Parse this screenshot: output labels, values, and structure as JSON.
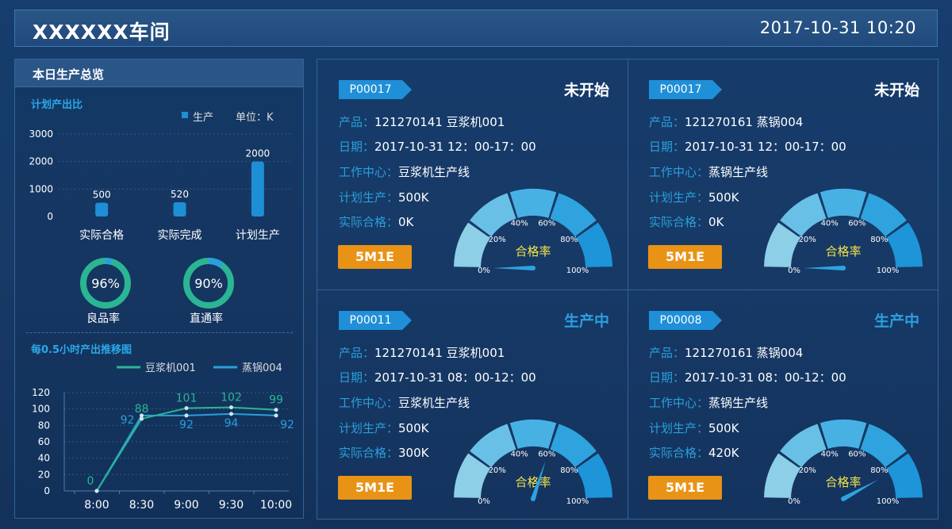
{
  "header": {
    "title": "XXXXXX车间",
    "datetime": "2017-10-31 10:20"
  },
  "overview": {
    "title": "本日生产总览",
    "plan_section": "计划产出比",
    "legend_label": "生产",
    "unit_label": "单位：K",
    "bar_color": "#1e8fd6"
  },
  "rates": [
    {
      "value": "96%",
      "label": "良品率",
      "fraction": 0.96
    },
    {
      "value": "90%",
      "label": "直通率",
      "fraction": 0.9
    }
  ],
  "trend": {
    "title": "每0.5小时产出推移图"
  },
  "chart_data": [
    {
      "type": "bar",
      "categories": [
        "实际合格",
        "实际完成",
        "计划生产"
      ],
      "series": [
        {
          "name": "生产",
          "values": [
            500,
            520,
            2000
          ]
        }
      ],
      "data_labels": [
        "500",
        "520",
        "2000"
      ],
      "y_ticks": [
        "3000",
        "2000",
        "1000",
        "0"
      ],
      "ylim": [
        0,
        3000
      ],
      "legend": "top-right"
    },
    {
      "type": "line",
      "categories": [
        "8:00",
        "8:30",
        "9:00",
        "9:30",
        "10:00"
      ],
      "series": [
        {
          "name": "豆浆机001",
          "values": [
            0,
            88,
            101,
            102,
            99
          ],
          "labels": [
            "0",
            "88",
            "101",
            "102",
            "99"
          ],
          "color": "#2bb593"
        },
        {
          "name": "蒸锅004",
          "values": [
            0,
            92,
            92,
            94,
            92
          ],
          "labels": [
            "",
            "92",
            "92",
            "94",
            "92"
          ],
          "color": "#2a9fd9"
        }
      ],
      "y_ticks": [
        "120",
        "100",
        "80",
        "60",
        "40",
        "20",
        "0"
      ],
      "ylim": [
        0,
        120
      ],
      "legend": "top-right"
    }
  ],
  "cards": [
    {
      "tag": "P00017",
      "status": "未开始",
      "status_color": "#ffffff",
      "labels": [
        "产品：",
        "日期：",
        "工作中心：",
        "计划生产：",
        "实际合格："
      ],
      "values": [
        "121270141  豆浆机001",
        "2017-10-31  12：00-17：00",
        "豆浆机生产线",
        "500K",
        "0K"
      ],
      "button": "5M1E",
      "gauge_value": 0.0
    },
    {
      "tag": "P00017",
      "status": "未开始",
      "status_color": "#ffffff",
      "labels": [
        "产品：",
        "日期：",
        "工作中心：",
        "计划生产：",
        "实际合格："
      ],
      "values": [
        "121270161  蒸锅004",
        "2017-10-31  12：00-17：00",
        "蒸锅生产线",
        "500K",
        "0K"
      ],
      "button": "5M1E",
      "gauge_value": 0.0
    },
    {
      "tag": "P00011",
      "status": "生产中",
      "status_color": "#2a9fe0",
      "labels": [
        "产品：",
        "日期：",
        "工作中心：",
        "计划生产：",
        "实际合格："
      ],
      "values": [
        "121270141  豆浆机001",
        "2017-10-31  08：00-12：00",
        "豆浆机生产线",
        "500K",
        "300K"
      ],
      "button": "5M1E",
      "gauge_value": 0.6
    },
    {
      "tag": "P00008",
      "status": "生产中",
      "status_color": "#2a9fe0",
      "labels": [
        "产品：",
        "日期：",
        "工作中心：",
        "计划生产：",
        "实际合格："
      ],
      "values": [
        "121270161  蒸锅004",
        "2017-10-31  08：00-12：00",
        "蒸锅生产线",
        "500K",
        "420K"
      ],
      "button": "5M1E",
      "gauge_value": 0.84
    }
  ],
  "gauge": {
    "label": "合格率",
    "ticks": [
      "0%",
      "20%",
      "40%",
      "60%",
      "80%",
      "100%"
    ],
    "colors": [
      "#8dcfe6",
      "#68c0e6",
      "#47b1e4",
      "#2ea3de",
      "#1d95d8"
    ]
  }
}
